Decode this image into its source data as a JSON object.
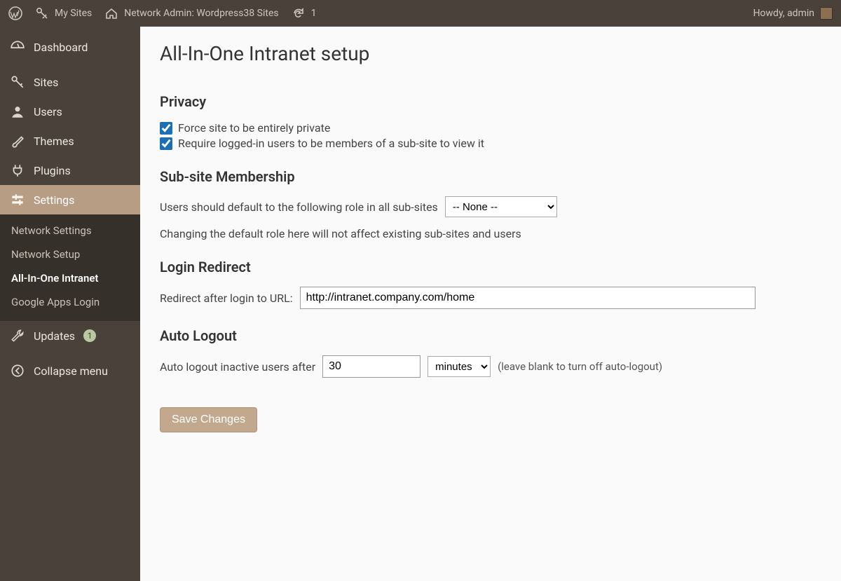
{
  "adminbar": {
    "my_sites": "My Sites",
    "site_name": "Network Admin: Wordpress38 Sites",
    "update_count": "1",
    "howdy": "Howdy, admin"
  },
  "sidebar": {
    "dashboard": "Dashboard",
    "sites": "Sites",
    "users": "Users",
    "themes": "Themes",
    "plugins": "Plugins",
    "settings": "Settings",
    "settings_sub": {
      "network_settings": "Network Settings",
      "network_setup": "Network Setup",
      "all_in_one": "All-In-One Intranet",
      "google_apps": "Google Apps Login"
    },
    "updates": "Updates",
    "updates_badge": "1",
    "collapse": "Collapse menu"
  },
  "page": {
    "title": "All-In-One Intranet setup",
    "privacy": {
      "heading": "Privacy",
      "force_private": "Force site to be entirely private",
      "require_member": "Require logged-in users to be members of a sub-site to view it"
    },
    "subsite": {
      "heading": "Sub-site Membership",
      "label": "Users should default to the following role in all sub-sites",
      "selected": "-- None --",
      "note": "Changing the default role here will not affect existing sub-sites and users"
    },
    "redirect": {
      "heading": "Login Redirect",
      "label": "Redirect after login to URL:",
      "value": "http://intranet.company.com/home"
    },
    "autologout": {
      "heading": "Auto Logout",
      "label": "Auto logout inactive users after",
      "value": "30",
      "unit_selected": "minutes",
      "hint": "(leave blank to turn off auto-logout)"
    },
    "save": "Save Changes"
  }
}
